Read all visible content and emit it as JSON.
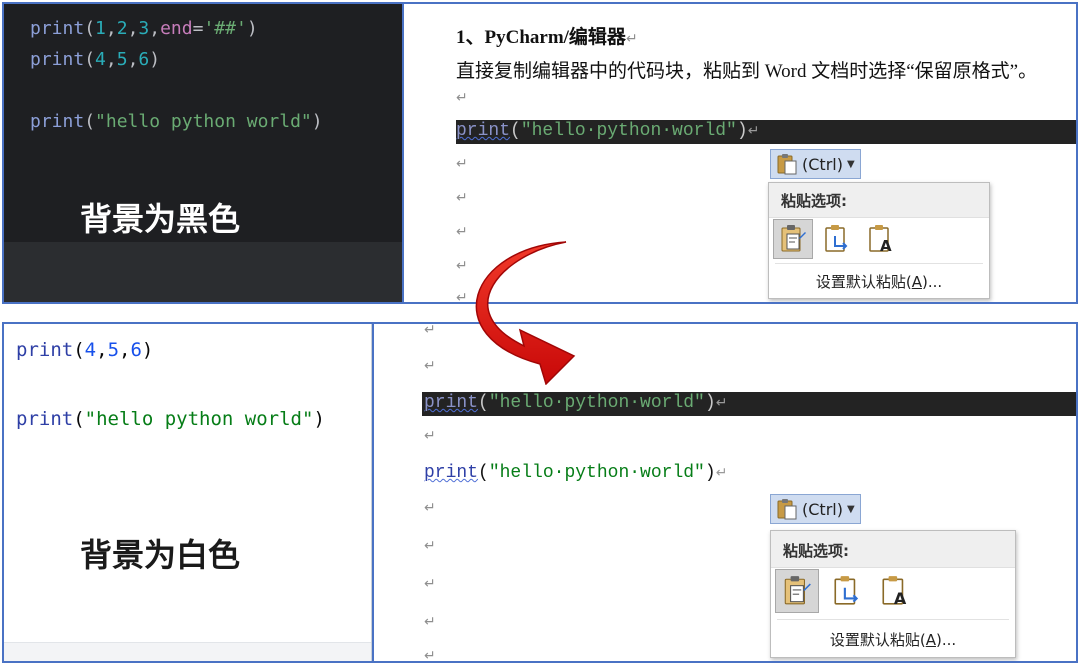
{
  "colors": {
    "panel_border": "#4a72c4",
    "dark_editor_bg": "#1e1f22",
    "light_editor_bg": "#ffffff",
    "arrow": "#e10d0d",
    "ctrl_button_bg": "#cfdcf0"
  },
  "top": {
    "editor": {
      "line1": {
        "fn": "print",
        "open": "(",
        "a": "1",
        "c1": ",",
        "b": "2",
        "c2": ",",
        "c": "3",
        "c3": ",",
        "kw": "end",
        "eq": "=",
        "str": "'##'",
        "close": ")"
      },
      "line2": {
        "fn": "print",
        "open": "(",
        "a": "4",
        "c1": ",",
        "b": "5",
        "c2": ",",
        "c": "6",
        "close": ")"
      },
      "line3": {
        "fn": "print",
        "open": "(",
        "str": "\"hello python world\"",
        "close": ")"
      },
      "caption": "背景为黑色"
    },
    "doc": {
      "heading": "1、PyCharm/编辑器",
      "heading_mark": "↵",
      "text": "直接复制编辑器中的代码块，粘贴到 Word 文档时选择“保留原格式”。",
      "para_mark": "↵",
      "code": {
        "fn": "print",
        "open": "(",
        "str": "\"hello·python·world\"",
        "close": ")",
        "mark": "↵"
      }
    }
  },
  "bottom": {
    "editor": {
      "line1": {
        "fn": "print",
        "open": "(",
        "a": "4",
        "c1": ",",
        "b": "5",
        "c2": ",",
        "c": "6",
        "close": ")"
      },
      "line2": {
        "fn": "print",
        "open": "(",
        "str": "\"hello python world\"",
        "close": ")"
      },
      "caption": "背景为白色"
    },
    "doc": {
      "para_mark": "↵",
      "code_dark": {
        "fn": "print",
        "open": "(",
        "str": "\"hello·python·world\"",
        "close": ")",
        "mark": "↵"
      },
      "code_light": {
        "fn": "print",
        "open": "(",
        "str": "\"hello·python·world\"",
        "close": ")",
        "mark": "↵"
      }
    }
  },
  "paste_popup": {
    "ctrl_label": "(Ctrl)",
    "menu_title": "粘贴选项:",
    "set_default_prefix": "设置默认粘贴(",
    "set_default_key": "A",
    "set_default_suffix": ")...",
    "option_icons": [
      "keep-source-formatting-icon",
      "merge-formatting-icon",
      "keep-text-only-icon"
    ],
    "text_only_letter": "A"
  }
}
